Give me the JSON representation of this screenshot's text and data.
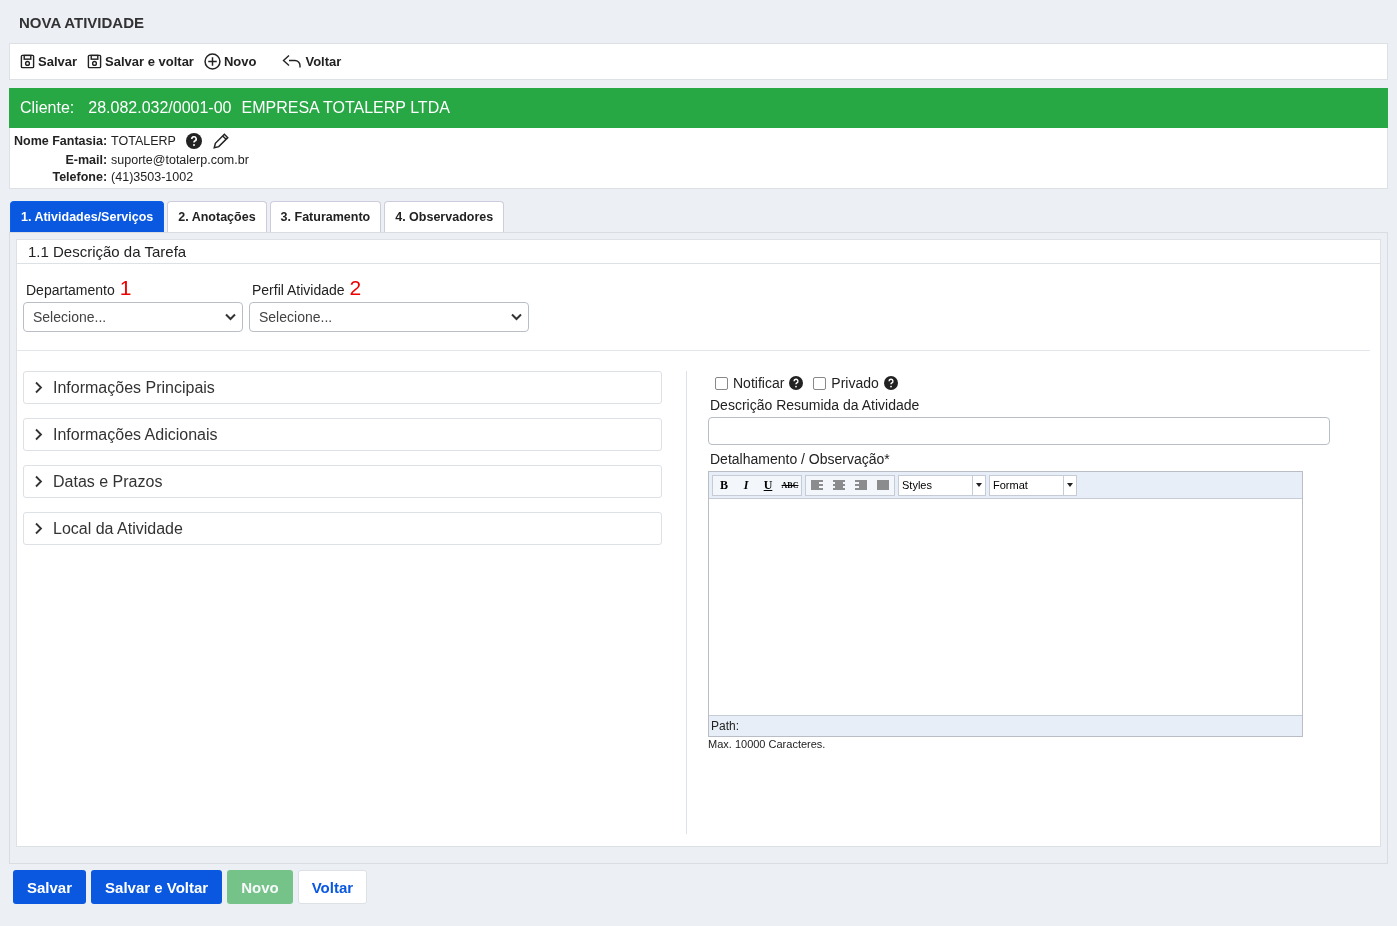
{
  "page_title": "NOVA ATIVIDADE",
  "toolbar": [
    {
      "label": "Salvar",
      "kind": "save"
    },
    {
      "label": "Salvar e voltar",
      "kind": "save"
    },
    {
      "label": "Novo",
      "kind": "add"
    },
    {
      "label": "Voltar",
      "kind": "back"
    }
  ],
  "client": {
    "label": "Cliente:",
    "document": "28.082.032/0001-00",
    "name": "EMPRESA TOTALERP LTDA",
    "details": [
      {
        "label": "Nome Fantasia:",
        "value": "TOTALERP"
      },
      {
        "label": "E-mail:",
        "value": "suporte@totalerp.com.br"
      },
      {
        "label": "Telefone:",
        "value": "(41)3503-1002"
      }
    ]
  },
  "tabs": [
    {
      "label": "1. Atividades/Serviços",
      "selected": true
    },
    {
      "label": "2. Anotações",
      "selected": false
    },
    {
      "label": "3. Faturamento",
      "selected": false
    },
    {
      "label": "4. Observadores",
      "selected": false
    }
  ],
  "section_title": "1.1 Descrição da Tarefa",
  "selects": [
    {
      "label": "Departamento",
      "marker": "1",
      "value": "Selecione..."
    },
    {
      "label": "Perfil Atividade",
      "marker": "2",
      "value": "Selecione..."
    }
  ],
  "accordion": [
    {
      "label": "Informações Principais",
      "expanded": false
    },
    {
      "label": "Informações Adicionais",
      "expanded": false
    },
    {
      "label": "Datas e Prazos",
      "expanded": false
    },
    {
      "label": "Local da Atividade",
      "expanded": false
    }
  ],
  "checkboxes": [
    {
      "label": "Notificar",
      "checked": false
    },
    {
      "label": "Privado",
      "checked": false
    }
  ],
  "summary_label": "Descrição Resumida da Atividade",
  "detail_label": "Detalhamento / Observação*",
  "editor": {
    "format_buttons": [
      {
        "label": "B",
        "kind": "bold"
      },
      {
        "label": "I",
        "kind": "italic"
      },
      {
        "label": "U",
        "kind": "underline"
      },
      {
        "label": "ABC",
        "kind": "strike"
      }
    ],
    "align_buttons": [
      {
        "kind": "left"
      },
      {
        "kind": "center"
      },
      {
        "kind": "right"
      },
      {
        "kind": "justify"
      }
    ],
    "dropdowns": [
      "Styles",
      "Format"
    ],
    "status": "Path:"
  },
  "char_limit": "Max. 10000 Caracteres.",
  "footer_buttons": [
    {
      "label": "Salvar",
      "kind": "primary",
      "disabled": false
    },
    {
      "label": "Salvar e Voltar",
      "kind": "primary",
      "disabled": false
    },
    {
      "label": "Novo",
      "kind": "success",
      "disabled": true
    },
    {
      "label": "Voltar",
      "kind": "light",
      "disabled": false
    }
  ]
}
